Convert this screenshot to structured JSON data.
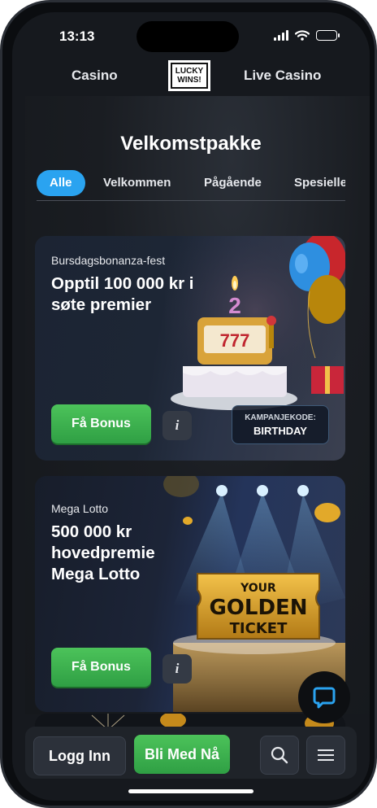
{
  "status": {
    "time": "13:13"
  },
  "nav": {
    "casino": "Casino",
    "live_casino": "Live Casino",
    "logo_line1": "LUCKY",
    "logo_line2": "WINS!"
  },
  "page": {
    "title": "Velkomstpakke"
  },
  "tabs": [
    {
      "label": "Alle",
      "active": true
    },
    {
      "label": "Velkommen",
      "active": false
    },
    {
      "label": "Pågående",
      "active": false
    },
    {
      "label": "Spesielle",
      "active": false
    }
  ],
  "promos": [
    {
      "eyebrow": "Bursdagsbonanza-fest",
      "headline": "Opptil 100 000 kr i søte premier",
      "cta": "Få Bonus",
      "info": "i",
      "promo_code_label": "KAMPANJEKODE:",
      "promo_code": "BIRTHDAY",
      "cake_digits": "777",
      "candle_number": "2"
    },
    {
      "eyebrow": "Mega Lotto",
      "headline": "500 000 kr hovedpremie Mega Lotto",
      "cta": "Få Bonus",
      "info": "i",
      "ticket_line1": "YOUR",
      "ticket_line2": "GOLDEN",
      "ticket_line3": "TICKET"
    }
  ],
  "bottom": {
    "login": "Logg Inn",
    "join": "Bli Med Nå"
  },
  "colors": {
    "accent_blue": "#2aa3f0",
    "cta_green": "#3fb550",
    "background": "#16191e"
  },
  "icons": [
    "signal-icon",
    "wifi-icon",
    "battery-icon",
    "chat-icon",
    "search-icon",
    "menu-icon"
  ]
}
